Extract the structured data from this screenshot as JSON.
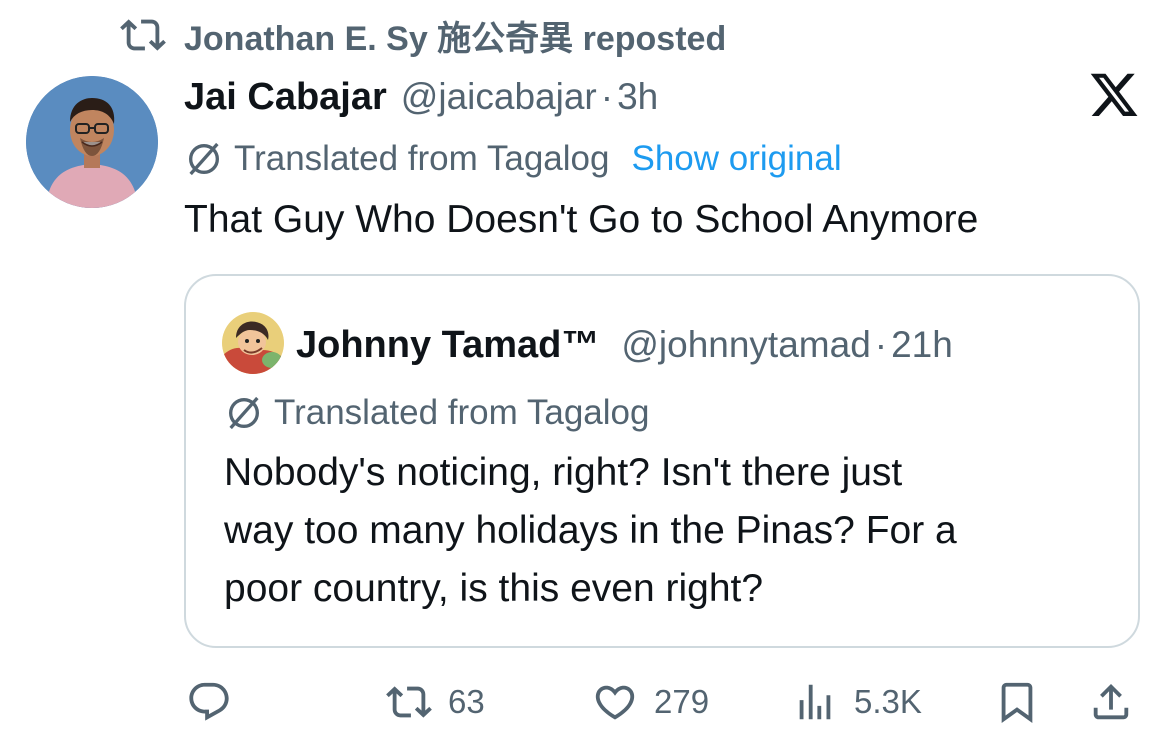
{
  "repost_banner": {
    "icon": "repost-icon",
    "text": "Jonathan E. Sy 施公奇異 reposted"
  },
  "post": {
    "author_name": "Jai Cabajar",
    "handle": "@jaicabajar",
    "separator": "·",
    "time": "3h",
    "translated_label": "Translated from Tagalog",
    "show_original_label": "Show original",
    "text": "That Guy Who Doesn't Go to School Anymore"
  },
  "quoted_post": {
    "author_name": "Johnny Tamad™",
    "handle": "@johnnytamad",
    "separator": "·",
    "time": "21h",
    "translated_label": "Translated from Tagalog",
    "text_lines": [
      "Nobody's noticing, right? Isn't there just",
      "way too many holidays in the Pinas? For a",
      "poor country, is this even right?"
    ]
  },
  "actions": {
    "reply": {
      "icon": "reply-icon",
      "count": ""
    },
    "repost": {
      "icon": "repost-icon",
      "count": "63"
    },
    "like": {
      "icon": "heart-icon",
      "count": "279"
    },
    "views": {
      "icon": "views-icon",
      "count": "5.3K"
    },
    "bookmark": {
      "icon": "bookmark-icon"
    },
    "share": {
      "icon": "share-icon"
    }
  },
  "colors": {
    "text_primary": "#0f1419",
    "text_secondary": "#536471",
    "link": "#1d9bf0",
    "border": "#cfd9de"
  }
}
